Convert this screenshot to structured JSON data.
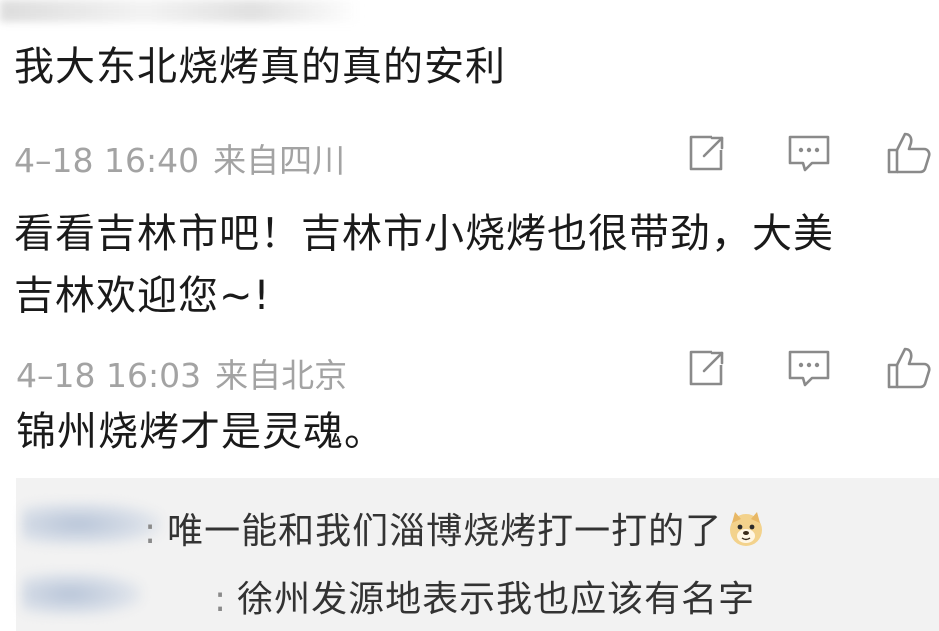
{
  "comments": [
    {
      "text": "我大东北烧烤真的真的安利",
      "time": "4–18 16:40",
      "location": "来自四川"
    },
    {
      "text_line1": "看看吉林市吧！吉林市小烧烤也很带劲，大美",
      "text_line2": "吉林欢迎您~!",
      "time": "4–18 16:03",
      "location": "来自北京"
    },
    {
      "text": "锦州烧烤才是灵魂。"
    }
  ],
  "replies": [
    {
      "separator": ":",
      "text": "唯一能和我们淄博烧烤打一打的了",
      "emoji": "doge-emoji"
    },
    {
      "separator": ":",
      "text": "徐州发源地表示我也应该有名字"
    }
  ],
  "icons": {
    "share": "share-icon",
    "comment": "comment-icon",
    "like": "thumbs-up-icon"
  },
  "colors": {
    "meta_text": "#a3a3a3",
    "reply_background": "#f2f2f2",
    "icon_stroke": "#8a8a8a"
  }
}
